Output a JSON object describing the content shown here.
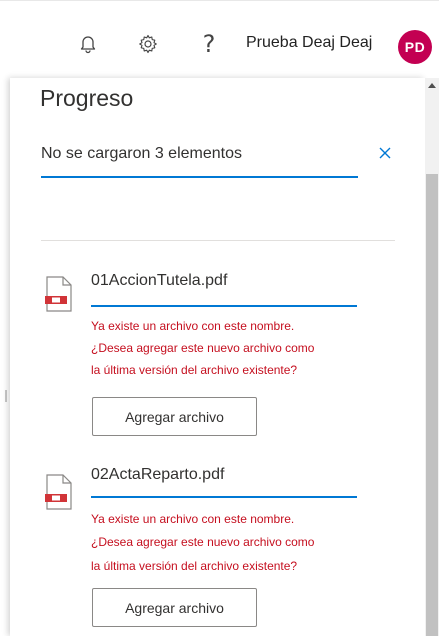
{
  "header": {
    "icons": [
      "bell-icon",
      "gear-icon",
      "help-icon"
    ],
    "help_glyph": "?",
    "user_name": "Prueba Deaj Deaj",
    "avatar_initials": "PD",
    "avatar_color": "#c30052"
  },
  "panel": {
    "title": "Progreso",
    "summary": "No se cargaron 3 elementos",
    "summary_progress": 1.0,
    "accent_color": "#0078d4",
    "error_color": "#c50f1f"
  },
  "items": [
    {
      "file_name": "01AccionTutela.pdf",
      "progress": 1.0,
      "error_lines": [
        "Ya existe un archivo con este nombre.",
        "¿Desea agregar este nuevo archivo como",
        "la última versión del archivo existente?"
      ],
      "button_label": "Agregar archivo"
    },
    {
      "file_name": "02ActaReparto.pdf",
      "progress": 1.0,
      "error_lines": [
        "Ya existe un archivo con este nombre.",
        "¿Desea agregar este nuevo archivo como",
        "la última versión del archivo existente?"
      ],
      "button_label": "Agregar archivo"
    }
  ]
}
